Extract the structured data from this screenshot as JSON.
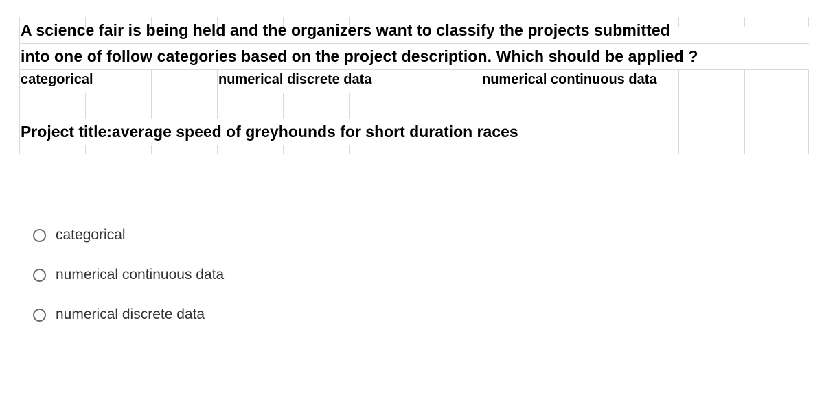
{
  "question": {
    "line1": "A science fair is being held and the organizers want to classify the  projects submitted",
    "line2": "into one of follow categories based on the project description. Which should be applied ?"
  },
  "categories": {
    "c1": "categorical",
    "c2": "numerical discrete data",
    "c3": "numerical continuous data"
  },
  "project_title": "Project title:average  speed of greyhounds  for short duration races",
  "options": [
    {
      "label": "categorical"
    },
    {
      "label": "numerical continuous data"
    },
    {
      "label": "numerical discrete data"
    }
  ]
}
